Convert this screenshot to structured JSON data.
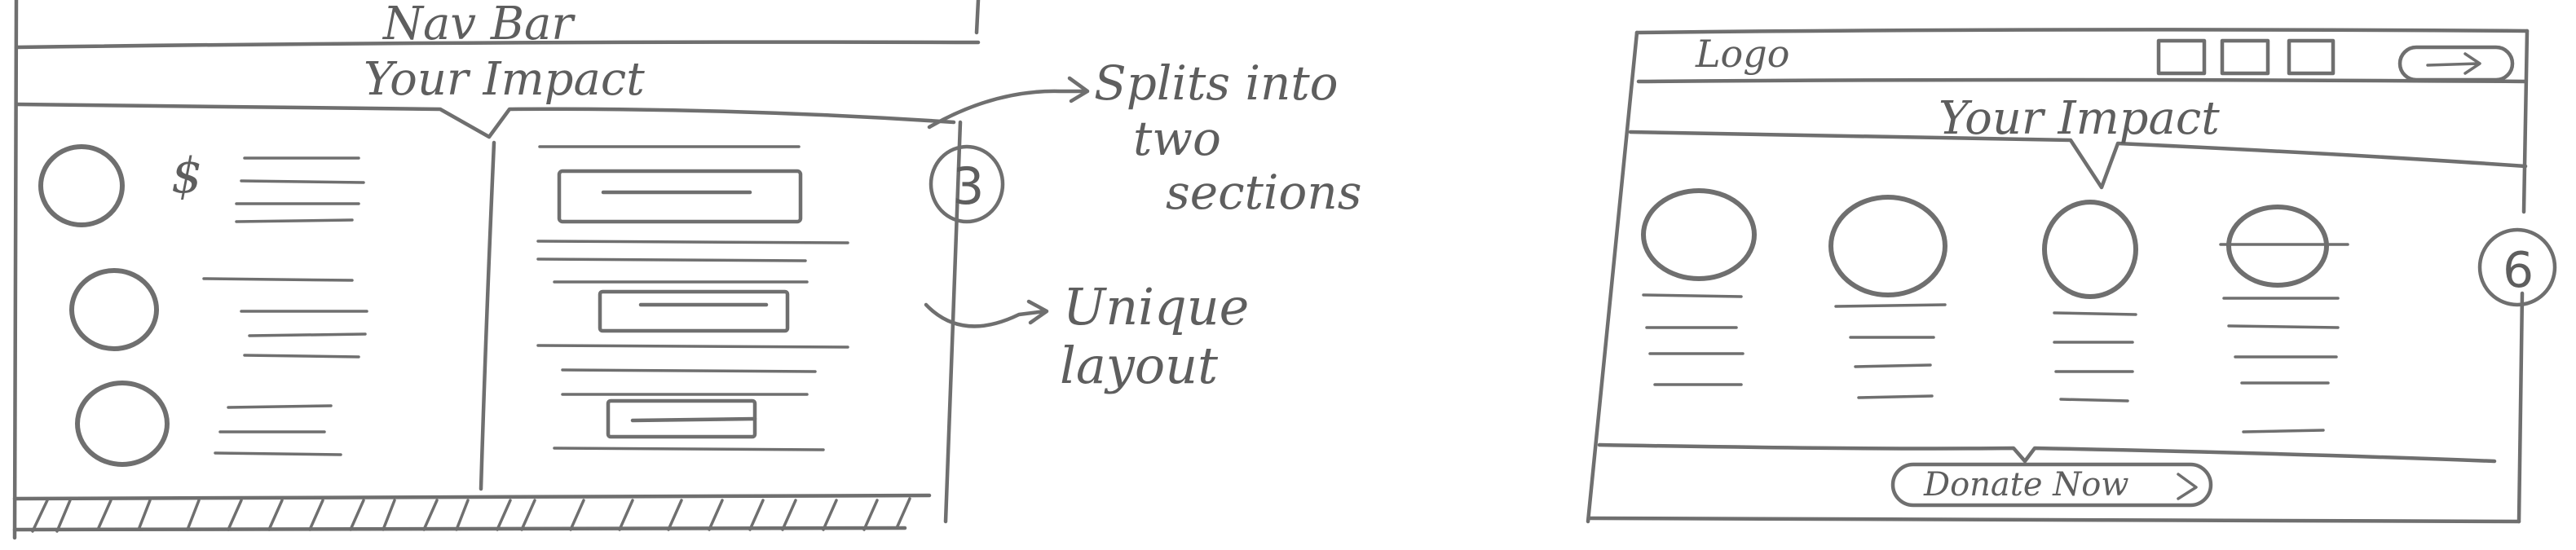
{
  "left_sketch": {
    "nav_label": "Nav Bar",
    "heading": "Your Impact",
    "dollar_sign": "$",
    "badge": "3"
  },
  "annotations": {
    "splits_line1": "Splits into",
    "splits_line2": "two",
    "splits_line3": "sections",
    "unique_line1": "Unique",
    "unique_line2": "layout"
  },
  "right_sketch": {
    "logo": "Logo",
    "heading": "Your Impact",
    "badge": "6",
    "donate_button": "Donate Now"
  }
}
